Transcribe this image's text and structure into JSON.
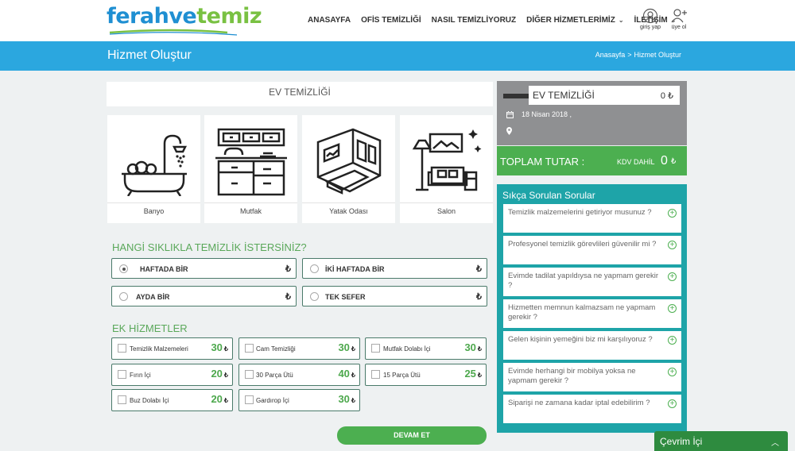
{
  "header": {
    "logo_part1": "ferahve",
    "logo_part2": "temiz",
    "nav": [
      {
        "label": "ANASAYFA",
        "has_dropdown": false
      },
      {
        "label": "OFİS TEMİZLİĞİ",
        "has_dropdown": false
      },
      {
        "label": "NASIL TEMİZLİYORUZ",
        "has_dropdown": false
      },
      {
        "label": "DİĞER HİZMETLERİMİZ",
        "has_dropdown": true
      },
      {
        "label": "İLETİŞİM",
        "has_dropdown": true
      }
    ],
    "login_label": "giriş yap",
    "signup_label": "üye ol"
  },
  "banner": {
    "title": "Hizmet Oluştur",
    "breadcrumb": [
      "Anasayfa",
      "Hizmet Oluştur"
    ],
    "separator": ">"
  },
  "service": {
    "title": "EV TEMİZLİĞİ",
    "rooms": [
      {
        "label": "Banyo",
        "icon": "bathtub-icon"
      },
      {
        "label": "Mutfak",
        "icon": "kitchen-icon"
      },
      {
        "label": "Yatak Odası",
        "icon": "bedroom-icon"
      },
      {
        "label": "Salon",
        "icon": "living-room-icon"
      }
    ]
  },
  "frequency": {
    "heading": "HANGİ SIKLIKLA TEMİZLİK İSTERSİNİZ?",
    "currency": "₺",
    "options": [
      {
        "label": "HAFTADA BİR",
        "selected": true
      },
      {
        "label": "İKİ HAFTADA BİR",
        "selected": false
      },
      {
        "label": "AYDA BİR",
        "selected": false
      },
      {
        "label": "TEK SEFER",
        "selected": false
      }
    ]
  },
  "extras": {
    "heading": "EK HİZMETLER",
    "currency": "₺",
    "items": [
      {
        "label": "Temizlik Malzemeleri",
        "price": "30"
      },
      {
        "label": "Cam Temizliği",
        "price": "30"
      },
      {
        "label": "Mutfak Dolabı İçi",
        "price": "30"
      },
      {
        "label": "Fırın İçi",
        "price": "20"
      },
      {
        "label": "30 Parça Ütü",
        "price": "40"
      },
      {
        "label": "15 Parça Ütü",
        "price": "25"
      },
      {
        "label": "Buz Dolabı İçi",
        "price": "20"
      },
      {
        "label": "Gardırop İçi",
        "price": "30"
      }
    ]
  },
  "next_button": "DEVAM ET",
  "summary": {
    "service_name": "EV TEMİZLİĞİ",
    "service_price": "0 ₺",
    "date": "18 Nisan 2018 ,"
  },
  "total": {
    "label": "TOPLAM TUTAR :",
    "kdv_label": "KDV DAHİL",
    "value": "0",
    "currency": "₺"
  },
  "faq": {
    "title": "Sıkça Sorulan Sorular",
    "items": [
      "Temizlik malzemelerini getiriyor musunuz ?",
      "Profesyonel temizlik görevlileri güvenilir mi ?",
      "Evimde tadilat yapıldıysa ne yapmam gerekir ?",
      "Hizmetten memnun kalmazsam ne yapmam gerekir ?",
      "Gelen kişinin yemeğini biz mi karşılıyoruz ?",
      "Evimde herhangi bir mobilya yoksa ne yapmam gerekir ?",
      "Siparişi ne zamana kadar iptal edebilirim ?"
    ]
  },
  "chat": {
    "label": "Çevrim İçi"
  },
  "colors": {
    "brand_blue": "#1f8fd2",
    "brand_green": "#79c142",
    "banner": "#2ba7df",
    "accent_green": "#4caf50",
    "faq_teal": "#1ea4a8"
  }
}
